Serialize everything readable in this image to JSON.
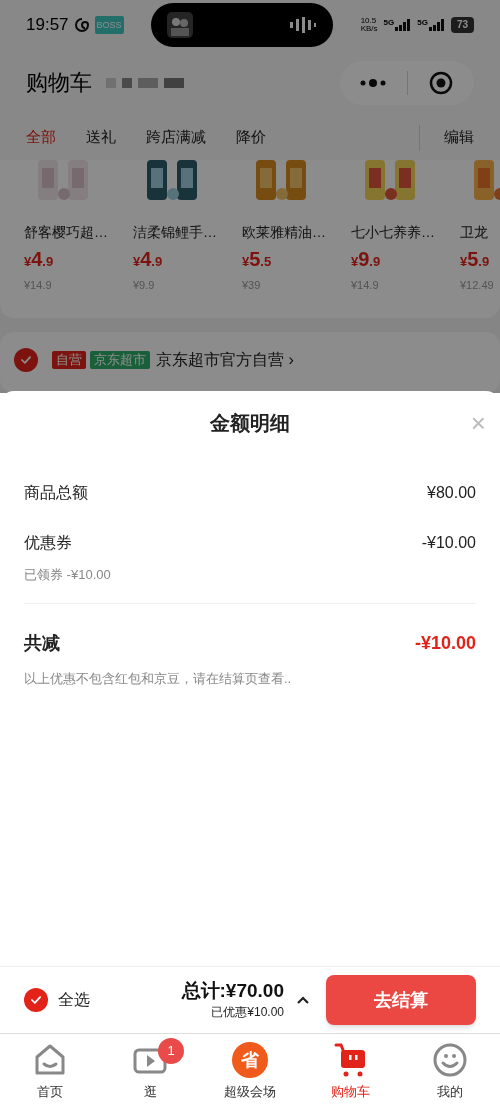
{
  "status_bar": {
    "time": "19:57",
    "app_badge": "BOSS",
    "speed": "10.5",
    "speed_unit": "KB/s",
    "networks": [
      "5G",
      "5G"
    ],
    "battery": "73"
  },
  "header": {
    "title": "购物车"
  },
  "tabs": [
    {
      "label": "全部",
      "selected": true
    },
    {
      "label": "送礼",
      "selected": false
    },
    {
      "label": "跨店满减",
      "selected": false
    },
    {
      "label": "降价",
      "selected": false
    }
  ],
  "edit_button": "编辑",
  "products": [
    {
      "name": "舒客樱巧超…",
      "price": "¥4.9",
      "original_price": "¥14.9"
    },
    {
      "name": "洁柔锦鲤手…",
      "price": "¥4.9",
      "original_price": "¥9.9"
    },
    {
      "name": "欧莱雅精油…",
      "price": "¥5.5",
      "original_price": "¥39"
    },
    {
      "name": "七小七养养…",
      "price": "¥9.9",
      "original_price": "¥14.9"
    },
    {
      "name": "卫龙",
      "price": "¥5.9",
      "original_price": "¥12.49"
    }
  ],
  "shop": {
    "checked": true,
    "tags": [
      {
        "label": "自营",
        "kind": "self"
      },
      {
        "label": "京东超市",
        "kind": "market"
      }
    ],
    "name": "京东超市官方自营 ›"
  },
  "sheet": {
    "title": "金额明细",
    "close": "×",
    "rows": [
      {
        "label": "商品总额",
        "value": "¥80.00",
        "note": null
      },
      {
        "label": "优惠券",
        "value": "-¥10.00",
        "note": "已领券 -¥10.00"
      }
    ],
    "total_label": "共减",
    "total_value": "-¥10.00",
    "footnote": "以上优惠不包含红包和京豆，请在结算页查看.."
  },
  "checkout_bar": {
    "select_all": {
      "label": "全选",
      "checked": true
    },
    "total": "总计:¥70.00",
    "discount": "已优惠¥10.00",
    "expanded": false,
    "button": "去结算"
  },
  "nav": [
    {
      "kind": "home",
      "label": "首页",
      "selected": false
    },
    {
      "kind": "video",
      "label": "逛",
      "selected": false,
      "badge": "1"
    },
    {
      "kind": "venue",
      "label": "超级会场",
      "selected": false,
      "icon_text": "省"
    },
    {
      "kind": "cart",
      "label": "购物车",
      "selected": true
    },
    {
      "kind": "profile",
      "label": "我的",
      "selected": false
    }
  ]
}
